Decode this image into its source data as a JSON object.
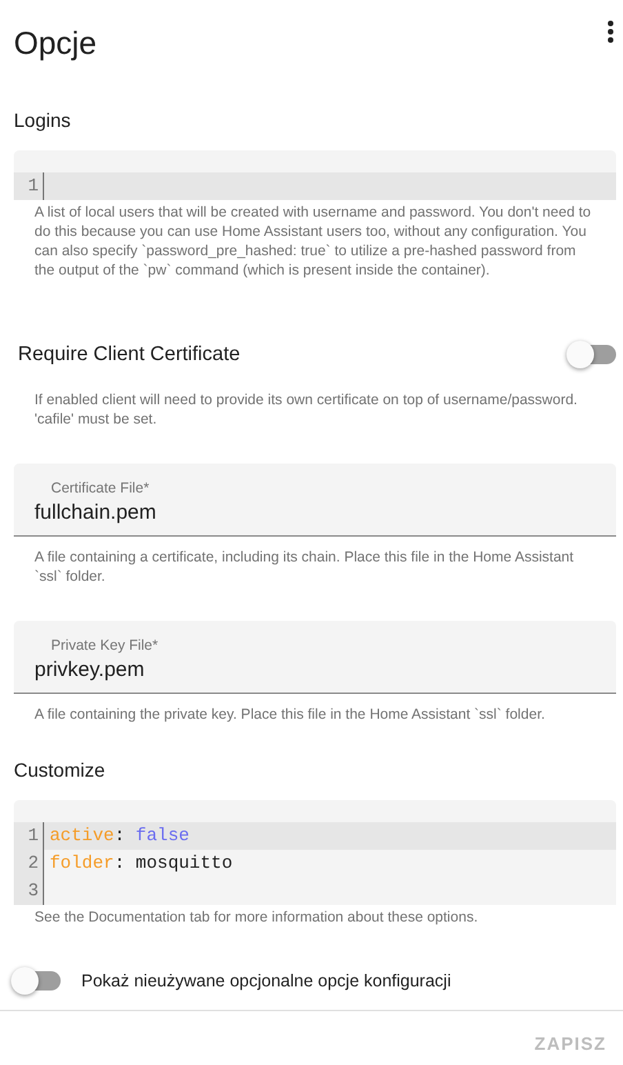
{
  "title": "Opcje",
  "sections": [
    {
      "kind": "editor",
      "heading": "Logins",
      "lines": [
        {
          "number": "1",
          "active": true
        }
      ],
      "help": "A list of local users that will be created with username and password. You don't need to do this because you can use Home Assistant users too, without any configuration. You can also specify `password_pre_hashed: true` to utilize a pre-hashed password from the output of the `pw` command (which is present inside the container)."
    },
    {
      "kind": "switch",
      "label": "Require Client Certificate",
      "on": false,
      "help": "If enabled client will need to provide its own certificate on top of username/password. 'cafile' must be set."
    },
    {
      "kind": "field",
      "label": "Certificate File*",
      "value": "fullchain.pem",
      "help": "A file containing a certificate, including its chain. Place this file in the Home Assistant `ssl` folder."
    },
    {
      "kind": "field",
      "label": "Private Key File*",
      "value": "privkey.pem",
      "help": "A file containing the private key. Place this file in the Home Assistant `ssl` folder."
    },
    {
      "kind": "editor",
      "heading": "Customize",
      "lines": [
        {
          "number": "1",
          "active": true,
          "tokens": [
            {
              "kind": "key",
              "text": "active"
            },
            {
              "kind": "plain",
              "text": ": "
            },
            {
              "kind": "atom",
              "text": "false"
            }
          ]
        },
        {
          "number": "2",
          "active": false,
          "tokens": [
            {
              "kind": "key",
              "text": "folder"
            },
            {
              "kind": "plain",
              "text": ": mosquitto"
            }
          ]
        },
        {
          "number": "3",
          "active": false
        }
      ],
      "help": "See the Documentation tab for more information about these options."
    }
  ],
  "optional_toggle": {
    "label": "Pokaż nieużywane opcjonalne opcje konfiguracji",
    "on": false
  },
  "save_button": {
    "label": "ZAPISZ",
    "disabled": true
  }
}
